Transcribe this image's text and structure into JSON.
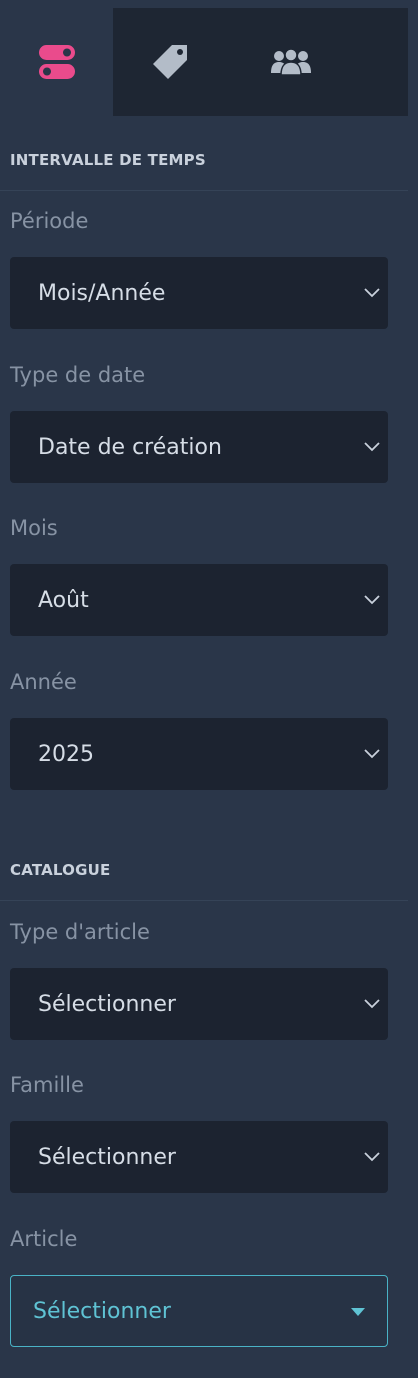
{
  "tabs": [
    {
      "icon": "toggle-icon",
      "active": true,
      "color": "#ea4b8c"
    },
    {
      "icon": "tag-icon",
      "active": false,
      "color": "#b3bcc8"
    },
    {
      "icon": "users-group-icon",
      "active": false,
      "color": "#b3bcc8"
    }
  ],
  "time_section": {
    "title": "INTERVALLE DE TEMPS",
    "periode": {
      "label": "Période",
      "value": "Mois/Année"
    },
    "type_date": {
      "label": "Type de date",
      "value": "Date de création"
    },
    "mois": {
      "label": "Mois",
      "value": "Août"
    },
    "annee": {
      "label": "Année",
      "value": "2025"
    }
  },
  "catalogue_section": {
    "title": "CATALOGUE",
    "type_article": {
      "label": "Type d'article",
      "value": "Sélectionner"
    },
    "famille": {
      "label": "Famille",
      "value": "Sélectionner"
    },
    "article": {
      "label": "Article",
      "value": "Sélectionner"
    }
  },
  "colors": {
    "accent_pink": "#ea4b8c",
    "accent_cyan": "#5fc3d4",
    "panel_bg": "#2a3649",
    "field_bg": "#1c2330"
  }
}
